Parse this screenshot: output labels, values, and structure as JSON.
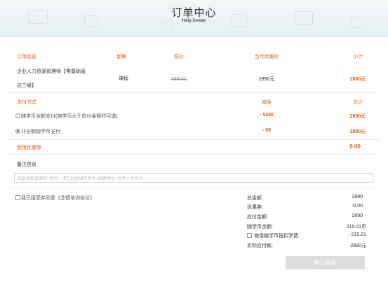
{
  "header": {
    "title": "订单中心",
    "subtitle": "Help Center"
  },
  "table": {
    "headers": {
      "info": "订单信息",
      "type": "套餐",
      "orig": "原价",
      "disc": "当月优惠价",
      "sub": "小计"
    },
    "row": {
      "name_line1": "企业人力资源管理师【零基础直",
      "name_line2": "达三级】",
      "type": "课程",
      "orig": "3890元",
      "disc": "2890元",
      "sub": "2890元"
    }
  },
  "payment": {
    "headers": {
      "method": "支付方式",
      "reduce": "减免",
      "total": "总计"
    },
    "options": [
      {
        "label": "随学币全额支付(随学币大于应付金额时可选)",
        "reduce": "- ¥200",
        "total": "2690元",
        "selected": false
      },
      {
        "label": "非全额随学币支付",
        "reduce": "- ¥0",
        "total": "2890元",
        "selected": true
      }
    ]
  },
  "coupon": {
    "label": "使用优惠券",
    "value": "0.00"
  },
  "remark": {
    "label": "备注信息",
    "placeholder": "如选择套餐课程+教材，请在此处填写姓名+邮寄地址+收件人手机号"
  },
  "agreement": {
    "label": "我已接受并同意《艾德培训协议》"
  },
  "summary": {
    "total_label": "总金额",
    "total": "2890",
    "coupon_label": "优惠券:",
    "coupon": "-0.00",
    "payable_label": "应付金额:",
    "payable": "2890",
    "balance_label": "随学币余额:",
    "balance": "215.01币",
    "use_label": "使用随学币抵扣学费:",
    "use": "- 215.01",
    "actual_label": "实际应付款:",
    "actual": "2890元"
  },
  "confirm_label": "确认购买"
}
